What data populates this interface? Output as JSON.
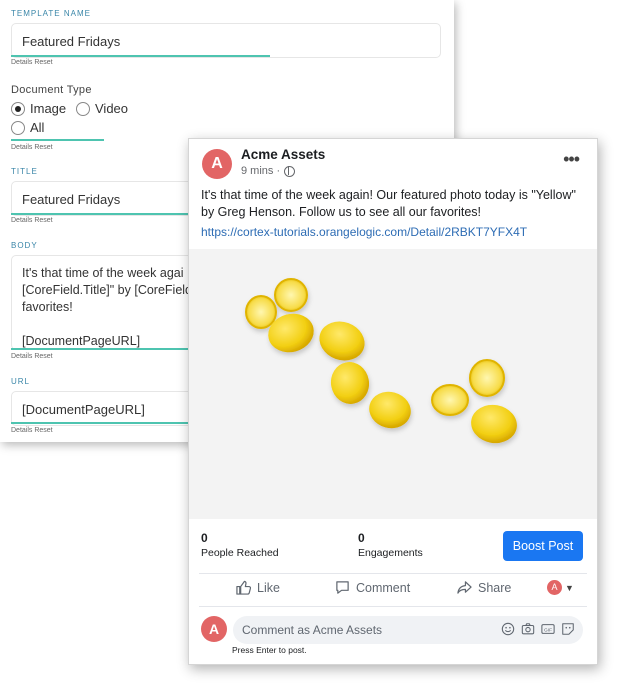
{
  "form": {
    "template_name_label": "TEMPLATE NAME",
    "template_name_value": "Featured Fridays",
    "details_reset": "Details Reset",
    "document_type_label": "Document Type",
    "options": [
      {
        "label": "Image",
        "selected": true
      },
      {
        "label": "Video",
        "selected": false
      },
      {
        "label": "All",
        "selected": false
      }
    ],
    "title_label": "TITLE",
    "title_value": "Featured Fridays",
    "body_label": "BODY",
    "body_value": "It's that time of the week agai\n[CoreField.Title]\" by [CoreField\nfavorites!\n\n[DocumentPageURL]",
    "url_label": "URL",
    "url_value": "[DocumentPageURL]",
    "accent_color": "#4ec4b0"
  },
  "post": {
    "page_name": "Acme Assets",
    "avatar_letter": "A",
    "time": "9 mins ·",
    "text": "It's that time of the week again! Our featured photo today is \"Yellow\" by Greg Henson. Follow us to see all our favorites!",
    "link": "https://cortex-tutorials.orangelogic.com/Detail/2RBKT7YFX4T",
    "photo_alt": "lemons",
    "stats": {
      "reached_value": "0",
      "reached_label": "People Reached",
      "engagements_value": "0",
      "engagements_label": "Engagements"
    },
    "boost_label": "Boost Post",
    "actions": {
      "like": "Like",
      "comment": "Comment",
      "share": "Share"
    },
    "comment_placeholder": "Comment as Acme Assets",
    "press_enter_hint": "Press Enter to post.",
    "accent_color": "#1a77f2"
  }
}
